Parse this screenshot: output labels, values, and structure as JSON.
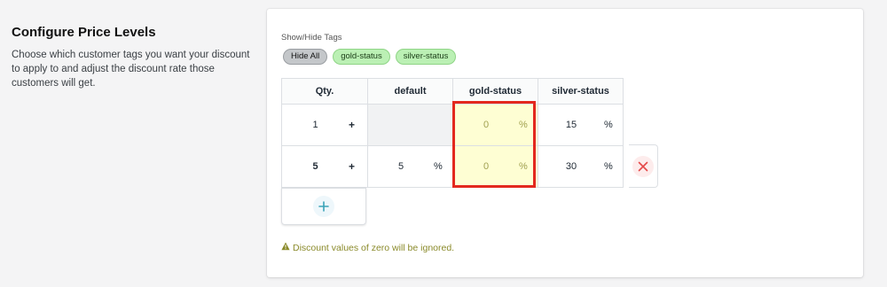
{
  "intro": {
    "title": "Configure Price Levels",
    "description": "Choose which customer tags you want your discount to apply to and adjust the discount rate those customers will get."
  },
  "tags": {
    "label": "Show/Hide Tags",
    "buttons": [
      {
        "label": "Hide All",
        "style": "neutral"
      },
      {
        "label": "gold-status",
        "style": "active"
      },
      {
        "label": "silver-status",
        "style": "active"
      }
    ]
  },
  "table": {
    "headers": [
      "Qty.",
      "default",
      "gold-status",
      "silver-status"
    ],
    "qty_plus_label": "+",
    "percent_symbol": "%",
    "rows": [
      {
        "qty": "1",
        "default": "",
        "gold": "0",
        "silver": "15"
      },
      {
        "qty": "5",
        "default": "5",
        "gold": "0",
        "silver": "30"
      }
    ]
  },
  "add_row_icon": "plus-icon",
  "remove_row_icon": "close-icon",
  "warning": {
    "icon": "warning-icon",
    "text": "Discount values of zero will be ignored."
  },
  "colors": {
    "highlight": "#e3281e",
    "tag_active": "#bbf0b4",
    "gold_cell": "#fefed3",
    "warning_text": "#8a8a2a",
    "remove_icon": "#e54848",
    "add_icon": "#3aa3b8"
  }
}
